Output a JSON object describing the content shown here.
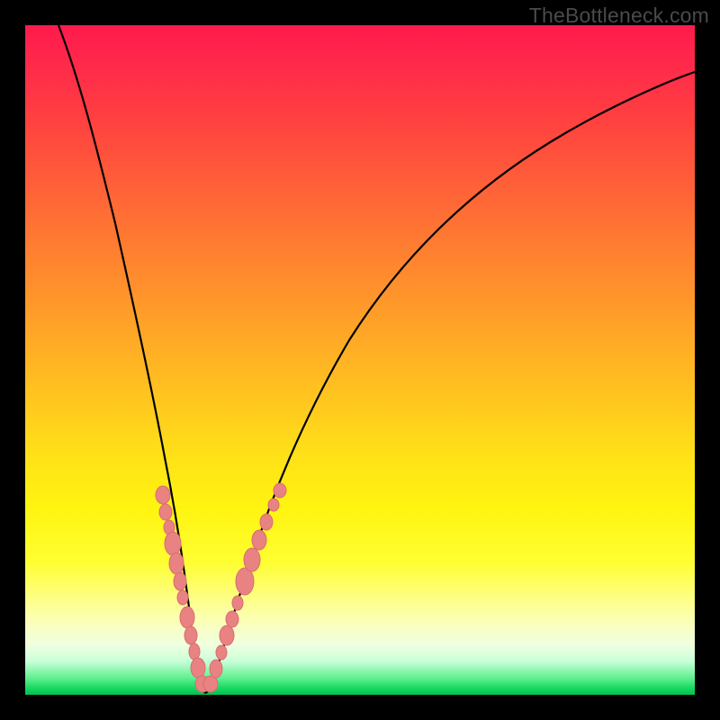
{
  "watermark": "TheBottleneck.com",
  "colors": {
    "background": "#000000",
    "gradient_top": "#ff1a4d",
    "gradient_mid": "#fff410",
    "gradient_bottom": "#00c050",
    "curve": "#000000",
    "beads": "#e98282"
  },
  "chart_data": {
    "type": "line",
    "title": "",
    "xlabel": "",
    "ylabel": "",
    "xlim": [
      0,
      100
    ],
    "ylim": [
      0,
      100
    ],
    "grid": false,
    "series": [
      {
        "name": "bottleneck-curve",
        "x": [
          5,
          7,
          9,
          11,
          13,
          15,
          17,
          19,
          20.5,
          22,
          23.5,
          24.5,
          25.5,
          26.5,
          28,
          30,
          32,
          34,
          37,
          41,
          46,
          52,
          60,
          70,
          82,
          95,
          100
        ],
        "y": [
          100,
          90,
          80,
          70,
          60,
          48,
          38,
          28,
          20,
          13,
          7,
          3,
          0.5,
          3,
          8,
          16,
          24,
          31,
          40,
          50,
          58,
          65,
          72,
          78,
          82.5,
          85.5,
          86.5
        ]
      }
    ],
    "annotations": [
      {
        "type": "bead-cluster",
        "x_range": [
          19,
          24
        ],
        "y_range": [
          2,
          30
        ],
        "side": "left"
      },
      {
        "type": "bead-cluster",
        "x_range": [
          26,
          34
        ],
        "y_range": [
          2,
          30
        ],
        "side": "right"
      }
    ]
  }
}
